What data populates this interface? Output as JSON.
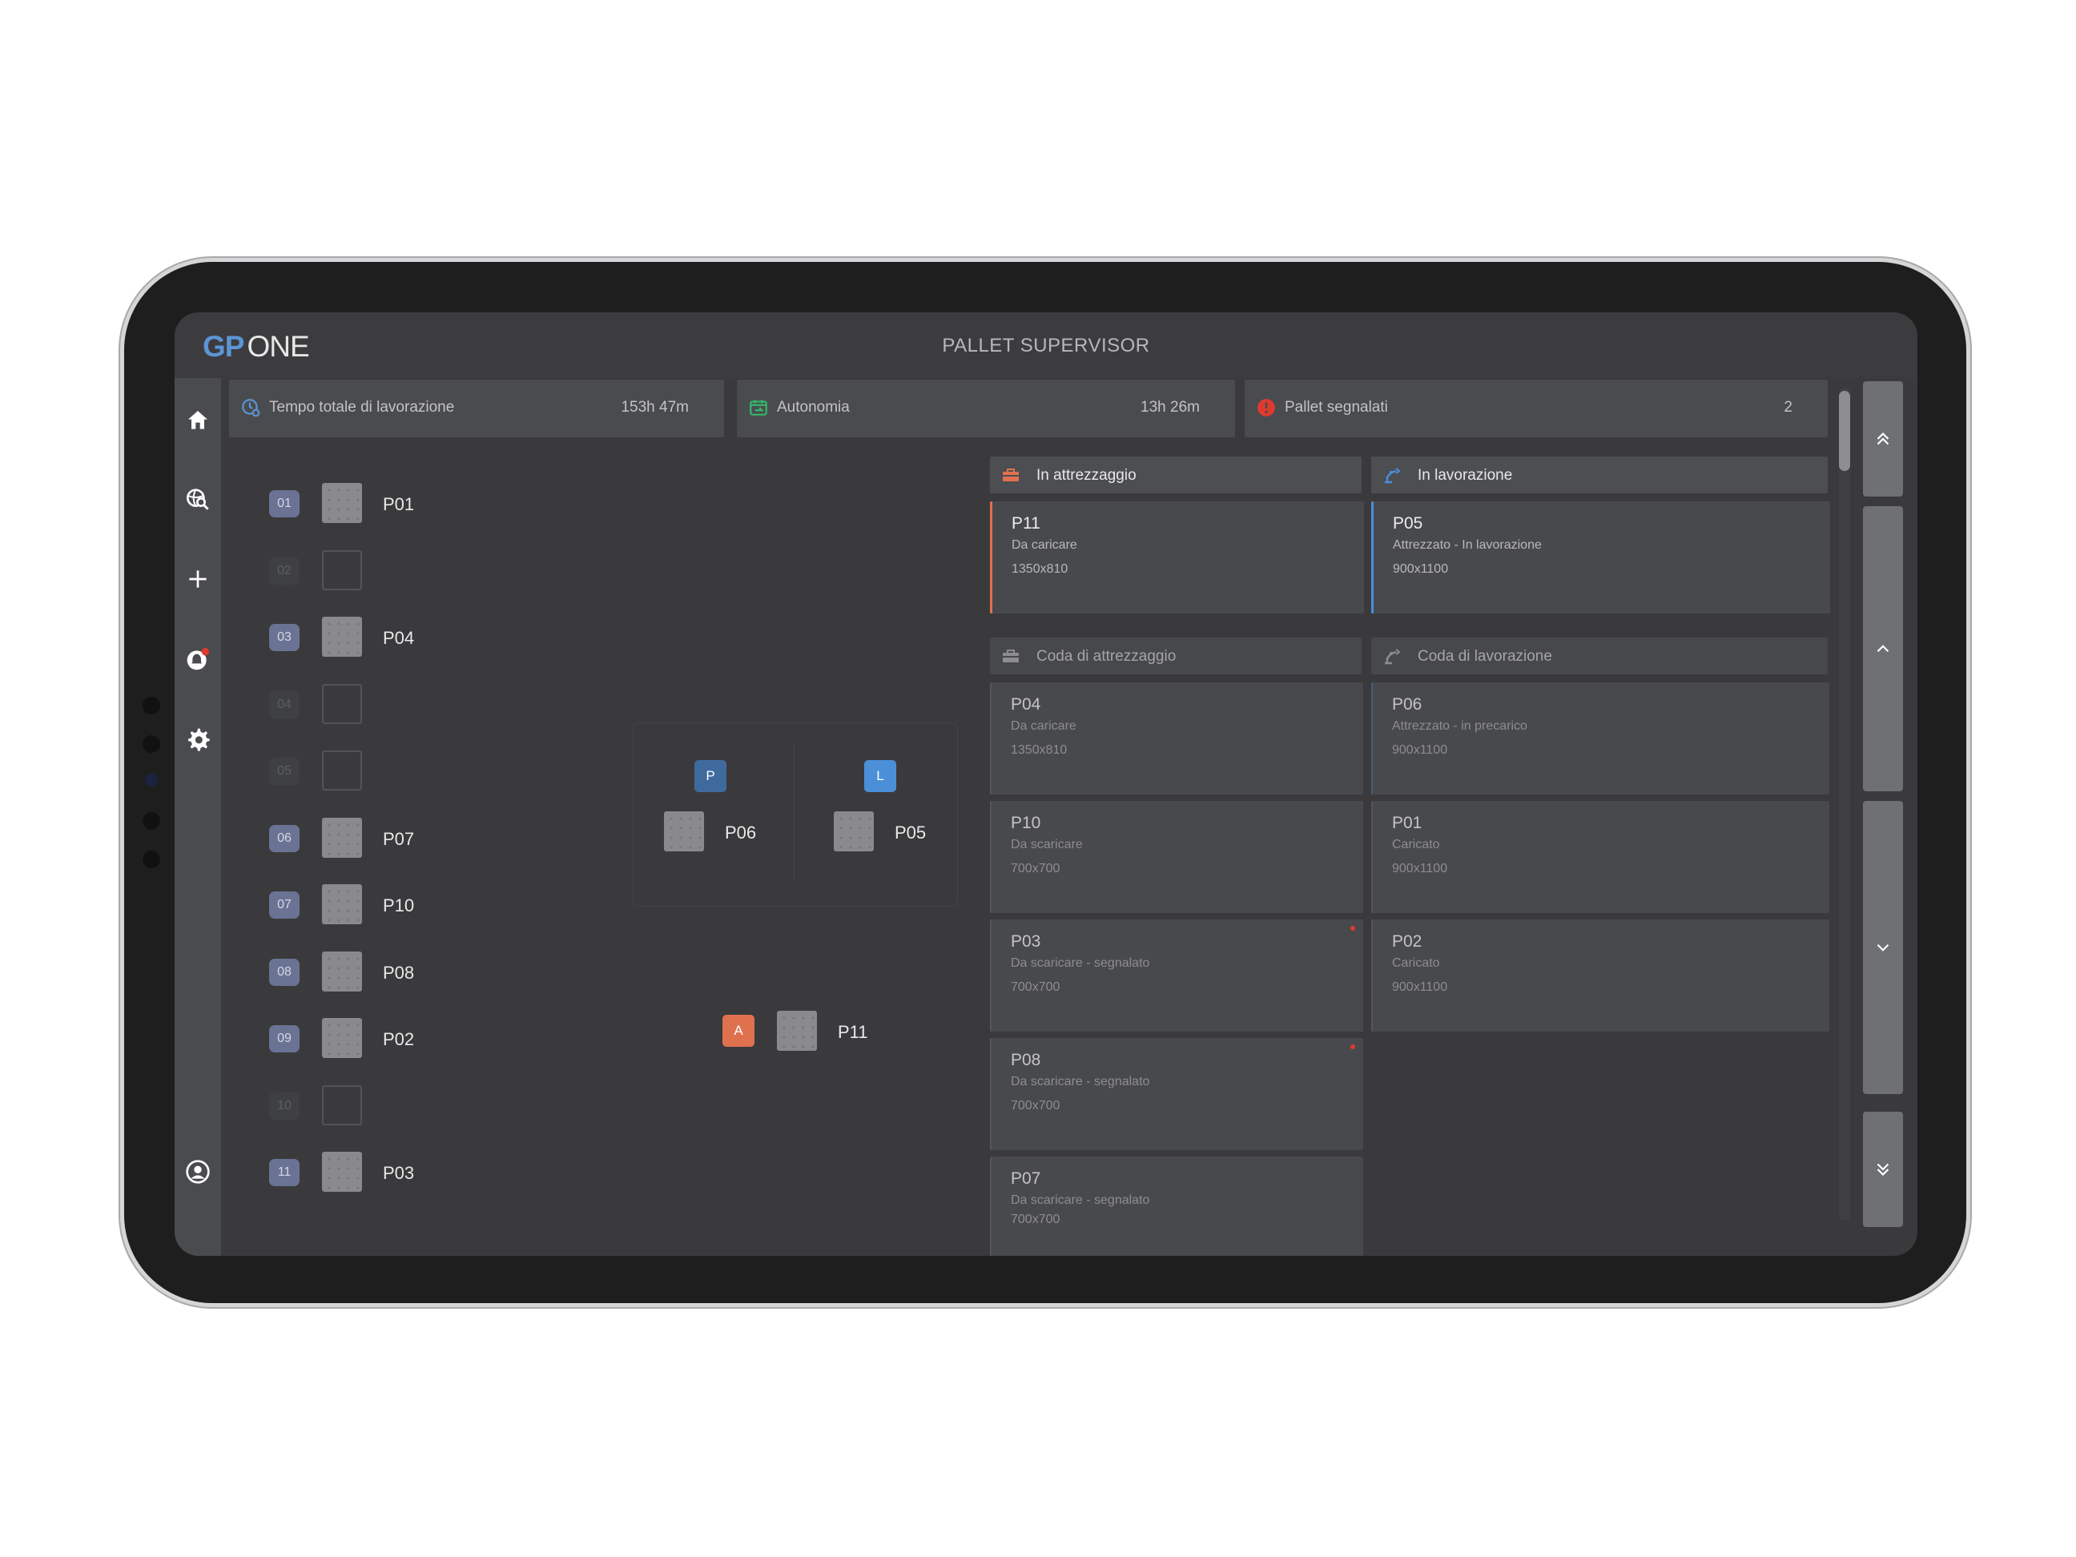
{
  "app": {
    "logo_gp": "GP",
    "logo_one": "ONE",
    "title": "PALLET SUPERVISOR"
  },
  "sidebar": {
    "items": [
      {
        "icon": "home-icon"
      },
      {
        "icon": "search-globe-icon"
      },
      {
        "icon": "plus-icon"
      },
      {
        "icon": "notification-icon"
      },
      {
        "icon": "gear-icon"
      },
      {
        "icon": "user-icon"
      }
    ]
  },
  "stats": [
    {
      "label": "Tempo totale di lavorazione",
      "value": "153h 47m",
      "icon": "clock-settings-icon",
      "icon_color": "#5b95d6"
    },
    {
      "label": "Autonomia",
      "value": "13h 26m",
      "icon": "calendar-refresh-icon",
      "icon_color": "#33b96a"
    },
    {
      "label": "Pallet segnalati",
      "value": "2",
      "icon": "alert-icon",
      "icon_color": "#e03a2f"
    }
  ],
  "slots": [
    {
      "num": "01",
      "pallet": "P01"
    },
    {
      "num": "02",
      "pallet": ""
    },
    {
      "num": "03",
      "pallet": "P04"
    },
    {
      "num": "04",
      "pallet": ""
    },
    {
      "num": "05",
      "pallet": ""
    },
    {
      "num": "06",
      "pallet": "P07"
    },
    {
      "num": "07",
      "pallet": "P10"
    },
    {
      "num": "08",
      "pallet": "P08"
    },
    {
      "num": "09",
      "pallet": "P02"
    },
    {
      "num": "10",
      "pallet": ""
    },
    {
      "num": "11",
      "pallet": "P03"
    }
  ],
  "station": {
    "left_tag": "P",
    "left_tag_color": "#3f6a9e",
    "left_pallet": "P06",
    "right_tag": "L",
    "right_tag_color": "#4a8fd8",
    "right_pallet": "P05"
  },
  "loading": {
    "tag": "A",
    "tag_color": "#e0714f",
    "pallet": "P11"
  },
  "columns": {
    "in_attrezzaggio": {
      "label": "In attrezzaggio",
      "accent": "#e0714f",
      "card": {
        "id": "P11",
        "status": "Da caricare",
        "dims": "1350x810"
      }
    },
    "in_lavorazione": {
      "label": "In lavorazione",
      "accent": "#4a8fd8",
      "card": {
        "id": "P05",
        "status": "Attrezzato - In lavorazione",
        "dims": "900x1100"
      }
    },
    "coda_attrezzaggio": {
      "label": "Coda di attrezzaggio",
      "cards": [
        {
          "id": "P04",
          "status": "Da caricare",
          "dims": "1350x810"
        },
        {
          "id": "P10",
          "status": "Da scaricare",
          "dims": "700x700"
        },
        {
          "id": "P03",
          "status": "Da scaricare - segnalato",
          "dims": "700x700"
        },
        {
          "id": "P08",
          "status": "Da scaricare - segnalato",
          "dims": "700x700"
        },
        {
          "id": "P07",
          "status": "Da scaricare - segnalato",
          "dims": "700x700"
        }
      ]
    },
    "coda_lavorazione": {
      "label": "Coda di lavorazione",
      "cards": [
        {
          "id": "P06",
          "status": "Attrezzato - in precarico",
          "dims": "900x1100"
        },
        {
          "id": "P01",
          "status": "Caricato",
          "dims": "900x1100"
        },
        {
          "id": "P02",
          "status": "Caricato",
          "dims": "900x1100"
        }
      ]
    }
  },
  "nav": [
    "double-chevron-up-icon",
    "chevron-up-icon",
    "chevron-down-icon",
    "double-chevron-down-icon"
  ]
}
